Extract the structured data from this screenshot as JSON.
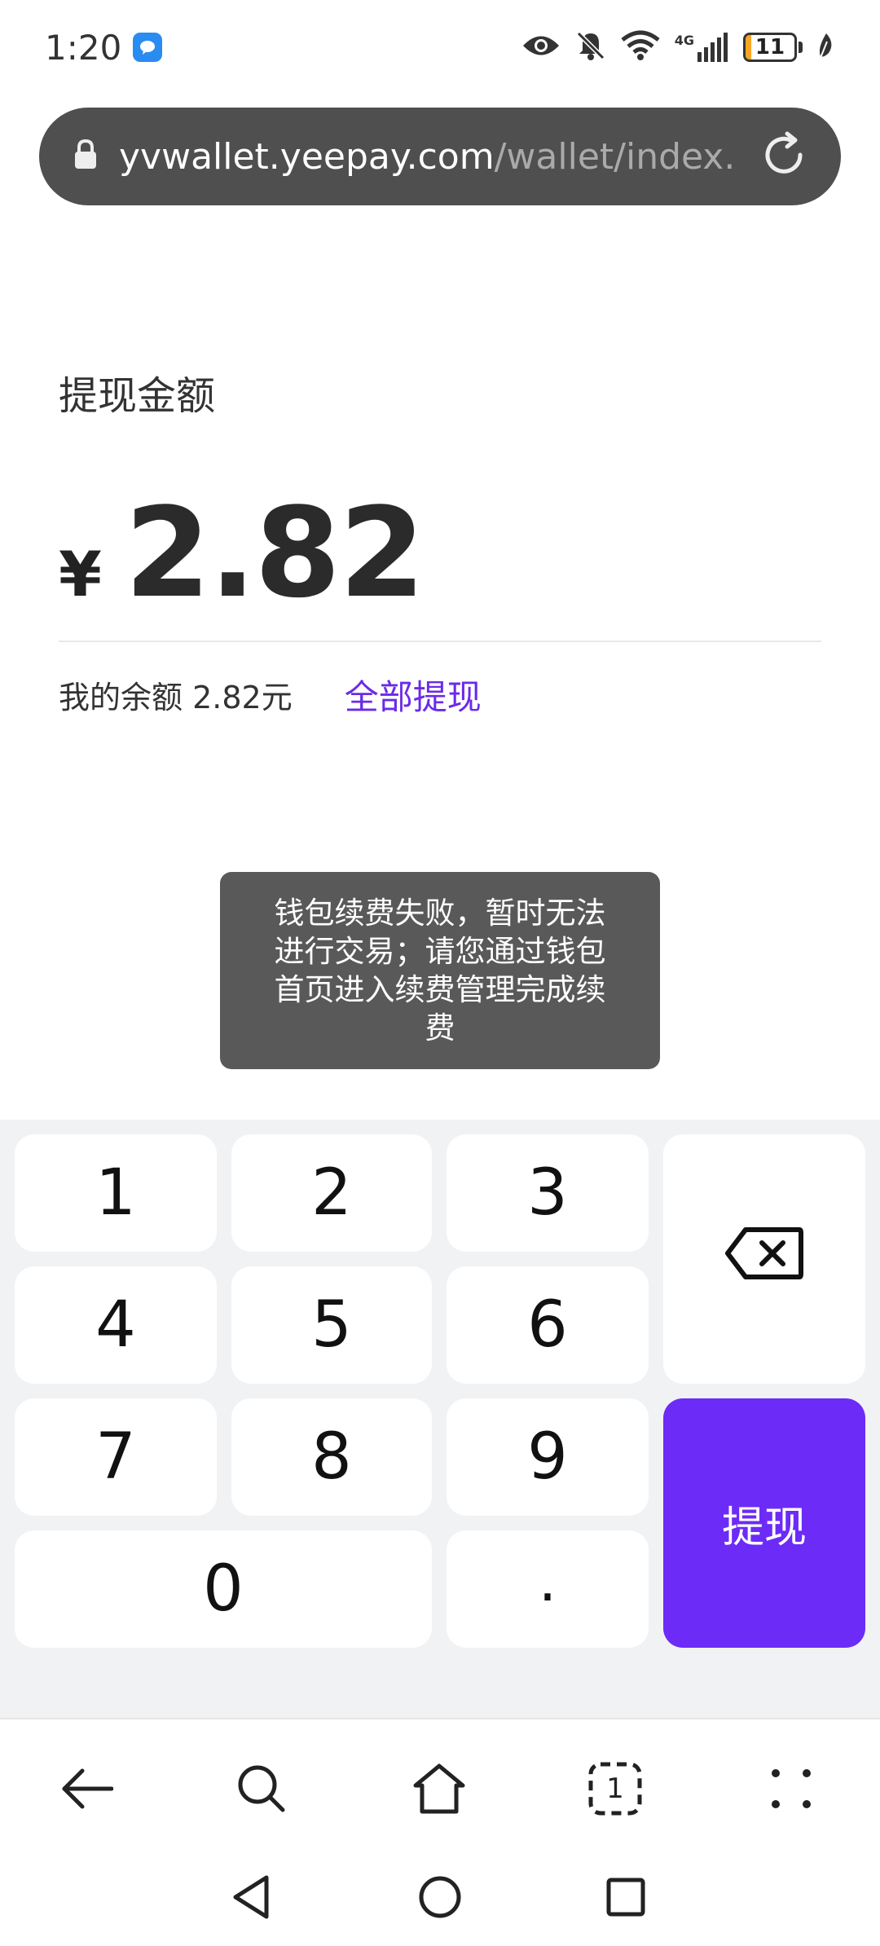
{
  "status_bar": {
    "time": "1:20",
    "network": "4G",
    "battery": "11",
    "battery_level_percent": 11,
    "battery_color": "#f5a623"
  },
  "url_bar": {
    "domain": "yvwallet.yeepay.com",
    "path": "/wallet/index.",
    "lock_icon": "lock-icon",
    "reload_icon": "reload-icon"
  },
  "withdraw": {
    "label": "提现金额",
    "currency": "¥",
    "amount": "2.82",
    "balance_text": "我的余额 2.82元",
    "withdraw_all": "全部提现"
  },
  "toast": {
    "message": "钱包续费失败，暂时无法进行交易；请您通过钱包首页进入续费管理完成续费"
  },
  "keypad": {
    "keys": [
      "1",
      "2",
      "3",
      "4",
      "5",
      "6",
      "7",
      "8",
      "9",
      "0",
      "."
    ],
    "submit": "提现",
    "accent": "#6c2bf7"
  },
  "browser_nav": [
    "back-icon",
    "search-icon",
    "home-icon",
    "tabs-icon",
    "menu-icon"
  ],
  "tabs_count": "1",
  "system_nav": [
    "back-triangle-icon",
    "home-circle-icon",
    "recents-square-icon"
  ]
}
